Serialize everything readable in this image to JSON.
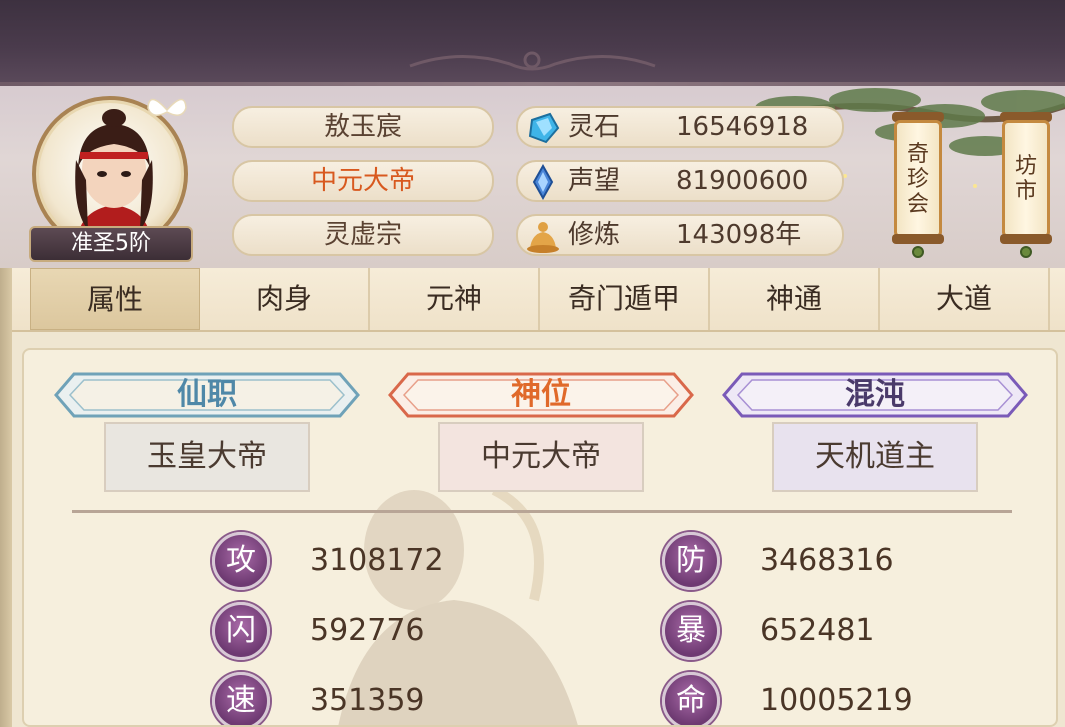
{
  "player": {
    "name": "敖玉宸",
    "title": "中元大帝",
    "sect": "灵虚宗",
    "rank": "准圣5阶"
  },
  "resources": [
    {
      "icon": "spirit-stone-icon",
      "label": "灵石",
      "value": "16546918"
    },
    {
      "icon": "reputation-icon",
      "label": "声望",
      "value": "81900600"
    },
    {
      "icon": "cultivation-icon",
      "label": "修炼",
      "value": "143098年"
    }
  ],
  "side_buttons": [
    {
      "label_lines": [
        "奇",
        "珍",
        "会"
      ]
    },
    {
      "label_lines": [
        "坊",
        "市"
      ]
    }
  ],
  "tabs": [
    {
      "label": "属性",
      "active": true
    },
    {
      "label": "肉身",
      "active": false
    },
    {
      "label": "元神",
      "active": false
    },
    {
      "label": "奇门遁甲",
      "active": false
    },
    {
      "label": "神通",
      "active": false
    },
    {
      "label": "大道",
      "active": false
    }
  ],
  "titles": [
    {
      "heading": "仙职",
      "value": "玉皇大帝",
      "color": "#4f88a8"
    },
    {
      "heading": "神位",
      "value": "中元大帝",
      "color": "#e0692a"
    },
    {
      "heading": "混沌",
      "value": "天机道主",
      "color": "#6a4a9a"
    }
  ],
  "stats": [
    {
      "label": "攻",
      "value": "3108172"
    },
    {
      "label": "防",
      "value": "3468316"
    },
    {
      "label": "闪",
      "value": "592776"
    },
    {
      "label": "暴",
      "value": "652481"
    },
    {
      "label": "速",
      "value": "351359"
    },
    {
      "label": "命",
      "value": "10005219"
    }
  ],
  "colors": {
    "accent_purple": "#6e3a72",
    "title_orange": "#d8591f",
    "text_brown": "#4e3a2d"
  }
}
